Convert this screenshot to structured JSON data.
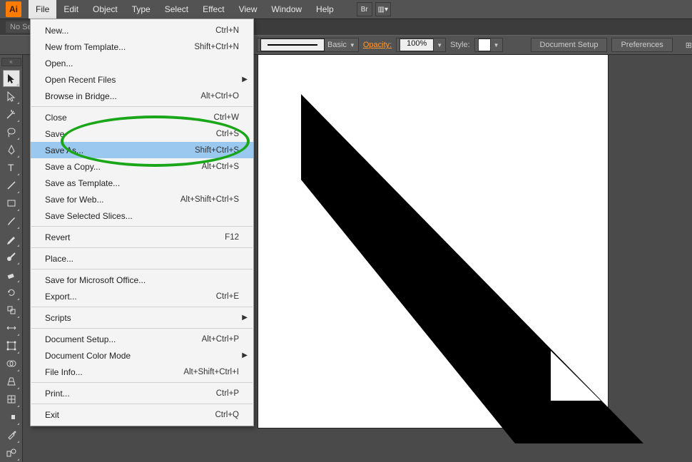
{
  "app": {
    "logo": "Ai"
  },
  "menubar": [
    "File",
    "Edit",
    "Object",
    "Type",
    "Select",
    "Effect",
    "View",
    "Window",
    "Help"
  ],
  "menubar_active_index": 0,
  "bridge_btn": "Br",
  "tabbar": {
    "nosel": "No Se"
  },
  "options": {
    "basic": "Basic",
    "opacity_label": "Opacity:",
    "opacity_value": "100%",
    "style_label": "Style:",
    "doc_setup": "Document Setup",
    "preferences": "Preferences"
  },
  "dropdown": {
    "groups": [
      [
        {
          "label": "New...",
          "shortcut": "Ctrl+N"
        },
        {
          "label": "New from Template...",
          "shortcut": "Shift+Ctrl+N"
        },
        {
          "label": "Open...",
          "shortcut": ""
        },
        {
          "label": "Open Recent Files",
          "shortcut": "",
          "submenu": true
        },
        {
          "label": "Browse in Bridge...",
          "shortcut": "Alt+Ctrl+O"
        }
      ],
      [
        {
          "label": "Close",
          "shortcut": "Ctrl+W"
        },
        {
          "label": "Save",
          "shortcut": "Ctrl+S"
        },
        {
          "label": "Save As...",
          "shortcut": "Shift+Ctrl+S",
          "highlight": true
        },
        {
          "label": "Save a Copy...",
          "shortcut": "Alt+Ctrl+S"
        },
        {
          "label": "Save as Template...",
          "shortcut": ""
        },
        {
          "label": "Save for Web...",
          "shortcut": "Alt+Shift+Ctrl+S"
        },
        {
          "label": "Save Selected Slices...",
          "shortcut": ""
        }
      ],
      [
        {
          "label": "Revert",
          "shortcut": "F12"
        }
      ],
      [
        {
          "label": "Place...",
          "shortcut": ""
        }
      ],
      [
        {
          "label": "Save for Microsoft Office...",
          "shortcut": ""
        },
        {
          "label": "Export...",
          "shortcut": "Ctrl+E"
        }
      ],
      [
        {
          "label": "Scripts",
          "shortcut": "",
          "submenu": true
        }
      ],
      [
        {
          "label": "Document Setup...",
          "shortcut": "Alt+Ctrl+P"
        },
        {
          "label": "Document Color Mode",
          "shortcut": "",
          "submenu": true
        },
        {
          "label": "File Info...",
          "shortcut": "Alt+Shift+Ctrl+I"
        }
      ],
      [
        {
          "label": "Print...",
          "shortcut": "Ctrl+P"
        }
      ],
      [
        {
          "label": "Exit",
          "shortcut": "Ctrl+Q"
        }
      ]
    ]
  },
  "tools": [
    "selection",
    "direct-selection",
    "magic-wand",
    "lasso",
    "pen",
    "type",
    "line",
    "rectangle",
    "paintbrush",
    "pencil",
    "blob-brush",
    "eraser",
    "rotate",
    "scale",
    "width",
    "free-transform",
    "shape-builder",
    "perspective",
    "mesh",
    "gradient",
    "eyedropper",
    "blend"
  ]
}
